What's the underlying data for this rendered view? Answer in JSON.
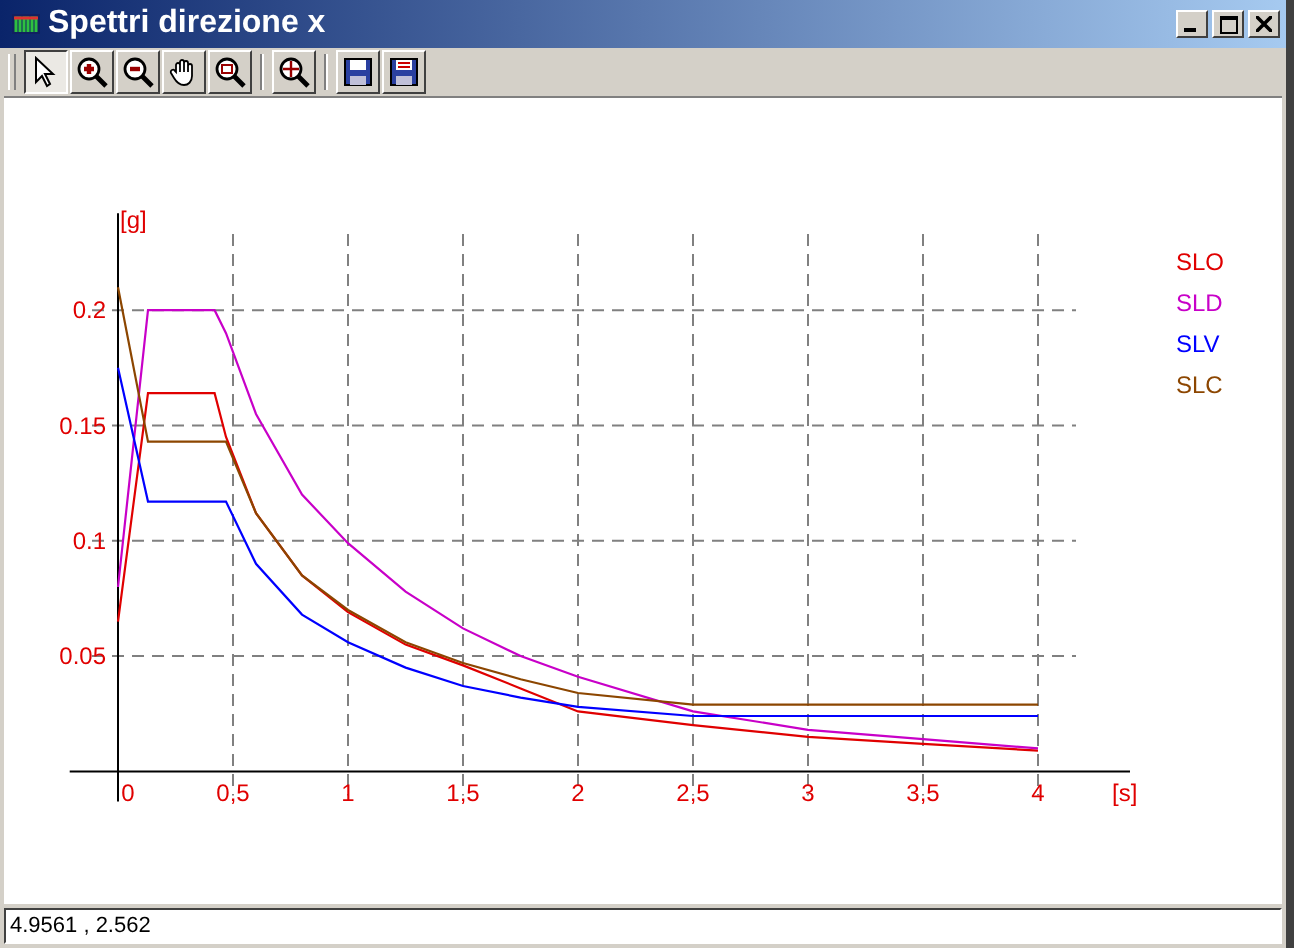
{
  "window": {
    "title": "Spettri direzione x"
  },
  "toolbar": [
    {
      "selected": true
    },
    {
      "selected": false
    },
    {
      "selected": false
    },
    {
      "selected": false
    },
    {
      "selected": false
    },
    {
      "selected": false
    },
    {
      "selected": false
    },
    {
      "selected": false
    }
  ],
  "chart": {
    "chart_data": {
      "type": "line",
      "xlabel": "[s]",
      "ylabel": "[g]",
      "x": [
        0,
        0.13,
        0.42,
        0.47,
        0.6,
        0.8,
        1,
        1.25,
        1.5,
        1.75,
        2,
        2.5,
        3,
        3.5,
        4
      ],
      "series": [
        {
          "name": "SLO",
          "color": "#e00000",
          "values": [
            0.065,
            0.164,
            0.164,
            0.145,
            0.112,
            0.085,
            0.069,
            0.055,
            0.046,
            0.036,
            0.026,
            0.02,
            0.015,
            0.012,
            0.009
          ]
        },
        {
          "name": "SLD",
          "color": "#c800c8",
          "values": [
            0.08,
            0.2,
            0.2,
            0.19,
            0.155,
            0.12,
            0.099,
            0.078,
            0.062,
            0.05,
            0.041,
            0.026,
            0.018,
            0.014,
            0.01
          ]
        },
        {
          "name": "SLV",
          "color": "#0000ff",
          "values": [
            0.175,
            0.117,
            0.117,
            0.117,
            0.09,
            0.068,
            0.056,
            0.045,
            0.037,
            0.032,
            0.028,
            0.024,
            0.024,
            0.024,
            0.024
          ]
        },
        {
          "name": "SLC",
          "color": "#8c4600",
          "values": [
            0.21,
            0.143,
            0.143,
            0.143,
            0.112,
            0.085,
            0.07,
            0.056,
            0.047,
            0.04,
            0.034,
            0.029,
            0.029,
            0.029,
            0.029
          ]
        }
      ],
      "xlim": [
        -0.21,
        4.4
      ],
      "ylim": [
        -0.013,
        0.242
      ],
      "grid": true,
      "xticks": [
        {
          "value": 0,
          "label": "0"
        },
        {
          "value": 0.5,
          "label": "0,5"
        },
        {
          "value": 1,
          "label": "1"
        },
        {
          "value": 1.5,
          "label": "1,5"
        },
        {
          "value": 2,
          "label": "2"
        },
        {
          "value": 2.5,
          "label": "2,5"
        },
        {
          "value": 3,
          "label": "3"
        },
        {
          "value": 3.5,
          "label": "3,5"
        },
        {
          "value": 4,
          "label": "4"
        }
      ],
      "yticks": [
        {
          "value": 0.05,
          "label": "0.05"
        },
        {
          "value": 0.1,
          "label": "0.1"
        },
        {
          "value": 0.15,
          "label": "0.15"
        },
        {
          "value": 0.2,
          "label": "0.2"
        }
      ]
    }
  },
  "status_bar": {
    "value": "4.9561 , 2.562"
  }
}
